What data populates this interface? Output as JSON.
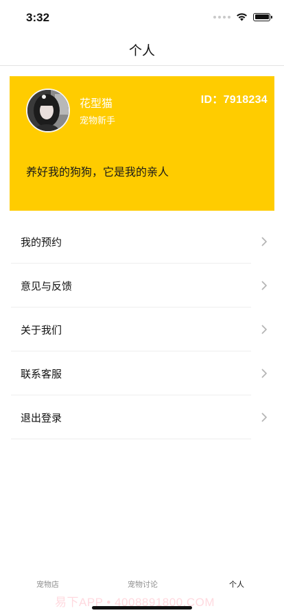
{
  "status_bar": {
    "time": "3:32",
    "icons": [
      "signal-dots-icon",
      "wifi-icon",
      "battery-icon"
    ]
  },
  "nav": {
    "title": "个人"
  },
  "profile": {
    "name": "花型猫",
    "level": "宠物新手",
    "id_label": "ID：7918234",
    "motto": "养好我的狗狗，它是我的亲人",
    "card_color": "#ffcc00",
    "avatar_icon": "user-avatar-photo"
  },
  "menu": {
    "items": [
      {
        "label": "我的预约"
      },
      {
        "label": "意见与反馈"
      },
      {
        "label": "关于我们"
      },
      {
        "label": "联系客服"
      },
      {
        "label": "退出登录"
      }
    ]
  },
  "tab_bar": {
    "tabs": [
      {
        "label": "宠物店",
        "active": false
      },
      {
        "label": "宠物讨论",
        "active": false
      },
      {
        "label": "个人",
        "active": true
      }
    ]
  },
  "watermark": "易下APP • 4008891800.COM"
}
